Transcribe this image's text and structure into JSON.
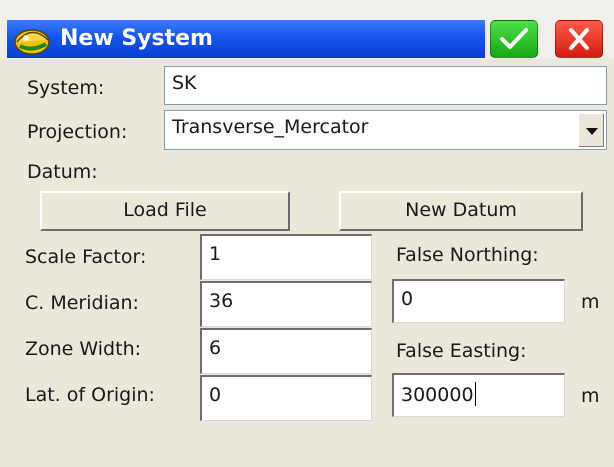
{
  "window": {
    "title": "New System",
    "ok_icon": "checkmark-icon",
    "close_icon": "close-icon"
  },
  "form": {
    "system_label": "System:",
    "system_value": "SK",
    "projection_label": "Projection:",
    "projection_value": "Transverse_Mercator",
    "datum_label": "Datum:",
    "load_file_label": "Load File",
    "new_datum_label": "New Datum",
    "scale_factor_label": "Scale Factor:",
    "scale_factor_value": "1",
    "c_meridian_label": "C. Meridian:",
    "c_meridian_value": "36",
    "zone_width_label": "Zone Width:",
    "zone_width_value": "6",
    "lat_origin_label": "Lat. of Origin:",
    "lat_origin_value": "0",
    "false_northing_label": "False Northing:",
    "false_northing_value": "0",
    "false_northing_unit": "m",
    "false_easting_label": "False Easting:",
    "false_easting_value": "300000",
    "false_easting_unit": "m"
  },
  "colors": {
    "titlebar": "#1554ee",
    "ok_button": "#17a816",
    "close_button": "#d61b10",
    "background": "#ebe7da"
  }
}
